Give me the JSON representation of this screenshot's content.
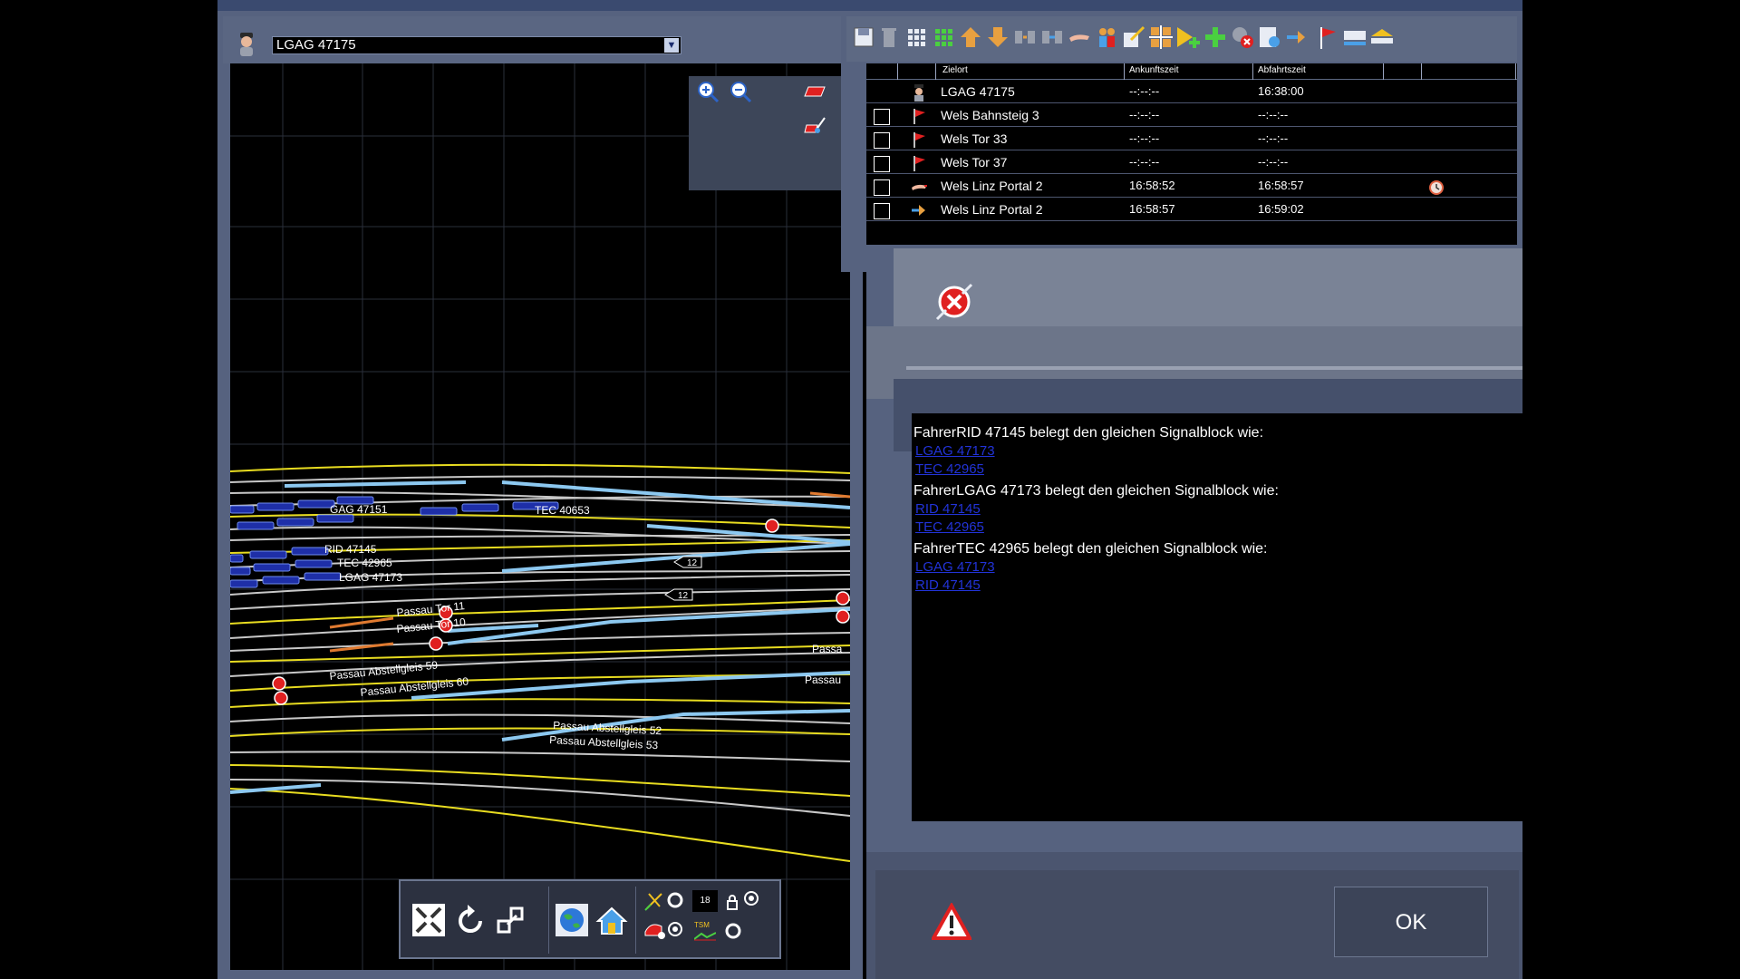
{
  "map": {
    "selected_train": "LGAG 47175",
    "track_labels": [
      "GAG 47151",
      "TEC 40653",
      "RID 47145",
      "TEC 42965",
      "LGAG 47173",
      "Passau Tor 11",
      "Passau Tor 10",
      "Passau Abstellgleis 59",
      "Passau Abstellgleis 60",
      "Passau Abstellgleis 52",
      "Passau Abstellgleis 53",
      "Passa",
      "Passau",
      "12",
      "12"
    ],
    "toolbar_counter": "18",
    "toolbar_small_label": "TSM"
  },
  "timetable": {
    "columns": [
      "Zielort",
      "Ankunftszeit",
      "Abfahrtszeit"
    ],
    "rows": [
      {
        "icon": "driver-icon",
        "dest": "LGAG 47175",
        "arr": "--:--:--",
        "dep": "16:38:00",
        "checkbox": false
      },
      {
        "icon": "flag-icon",
        "dest": "Wels Bahnsteig 3",
        "arr": "--:--:--",
        "dep": "--:--:--",
        "checkbox": true
      },
      {
        "icon": "flag-icon",
        "dest": "Wels Tor 33",
        "arr": "--:--:--",
        "dep": "--:--:--",
        "checkbox": true
      },
      {
        "icon": "flag-icon",
        "dest": "Wels Tor 37",
        "arr": "--:--:--",
        "dep": "--:--:--",
        "checkbox": true
      },
      {
        "icon": "couple-icon",
        "dest": "Wels Linz Portal 2",
        "arr": "16:58:52",
        "dep": "16:58:57",
        "checkbox": true,
        "alarm": true
      },
      {
        "icon": "transfer-icon",
        "dest": "Wels Linz Portal 2",
        "arr": "16:58:57",
        "dep": "16:59:02",
        "checkbox": true
      }
    ]
  },
  "dialog": {
    "messages": [
      {
        "header": "FahrerRID 47145 belegt den gleichen Signalblock wie:",
        "links": [
          "LGAG 47173",
          "TEC 42965"
        ]
      },
      {
        "header": "FahrerLGAG 47173 belegt den gleichen Signalblock wie:",
        "links": [
          "RID 47145",
          "TEC 42965"
        ]
      },
      {
        "header": "FahrerTEC 42965 belegt den gleichen Signalblock wie:",
        "links": [
          "LGAG 47173",
          "RID 47145"
        ]
      }
    ],
    "ok_label": "OK"
  },
  "colors": {
    "track_white": "#c8c8c8",
    "track_yellow": "#e8dc20",
    "track_blue": "#8cc8f0",
    "train_blue": "#1e2fa8",
    "signal_red": "#e02020",
    "link_blue": "#2233d8"
  }
}
